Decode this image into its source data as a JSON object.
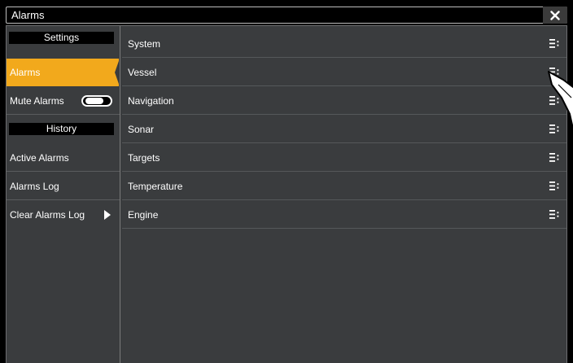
{
  "window": {
    "title": "Alarms"
  },
  "sidebar": {
    "settings_header": "Settings",
    "alarms_label": "Alarms",
    "mute_alarms_label": "Mute Alarms",
    "mute_alarms_on": false,
    "history_header": "History",
    "active_alarms_label": "Active Alarms",
    "alarms_log_label": "Alarms Log",
    "clear_alarms_log_label": "Clear Alarms Log"
  },
  "categories": [
    {
      "label": "System"
    },
    {
      "label": "Vessel"
    },
    {
      "label": "Navigation"
    },
    {
      "label": "Sonar"
    },
    {
      "label": "Targets"
    },
    {
      "label": "Temperature"
    },
    {
      "label": "Engine"
    }
  ],
  "icons": {
    "close": "close-icon",
    "row_menu": "menu-icon",
    "clear_arrow": "play-arrow-icon",
    "pointer": "hand-pointer-icon"
  },
  "colors": {
    "accent": "#f2a91c",
    "panel": "#3a3c3e",
    "header_bg": "#000000"
  }
}
